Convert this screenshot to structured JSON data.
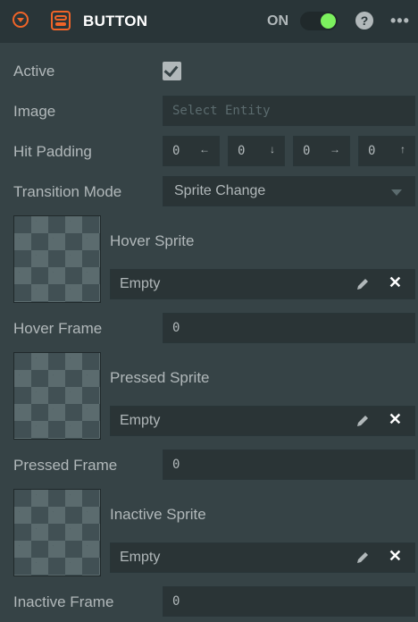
{
  "header": {
    "title": "BUTTON",
    "toggle_label": "ON",
    "toggle_state": "on",
    "help_label": "?",
    "more_label": "•••",
    "accent_color": "#f06428",
    "toggle_color": "#7cf05e"
  },
  "fields": {
    "active": {
      "label": "Active",
      "checked": true
    },
    "image": {
      "label": "Image",
      "placeholder": "Select Entity"
    },
    "hit_padding": {
      "label": "Hit Padding",
      "values": [
        "0",
        "0",
        "0",
        "0"
      ],
      "arrows": [
        "←",
        "↓",
        "→",
        "↑"
      ]
    },
    "transition_mode": {
      "label": "Transition Mode",
      "value": "Sprite Change"
    }
  },
  "sprites": [
    {
      "label": "Hover Sprite",
      "value": "Empty",
      "frame_label": "Hover Frame",
      "frame_value": "0"
    },
    {
      "label": "Pressed Sprite",
      "value": "Empty",
      "frame_label": "Pressed Frame",
      "frame_value": "0"
    },
    {
      "label": "Inactive Sprite",
      "value": "Empty",
      "frame_label": "Inactive Frame",
      "frame_value": "0"
    }
  ],
  "icons": {
    "collapse": "collapse-arrow-icon",
    "component": "button-component-icon",
    "edit": "pencil-icon",
    "clear": "close-icon",
    "dropdown": "caret-down-icon"
  },
  "clear_glyph": "✕"
}
